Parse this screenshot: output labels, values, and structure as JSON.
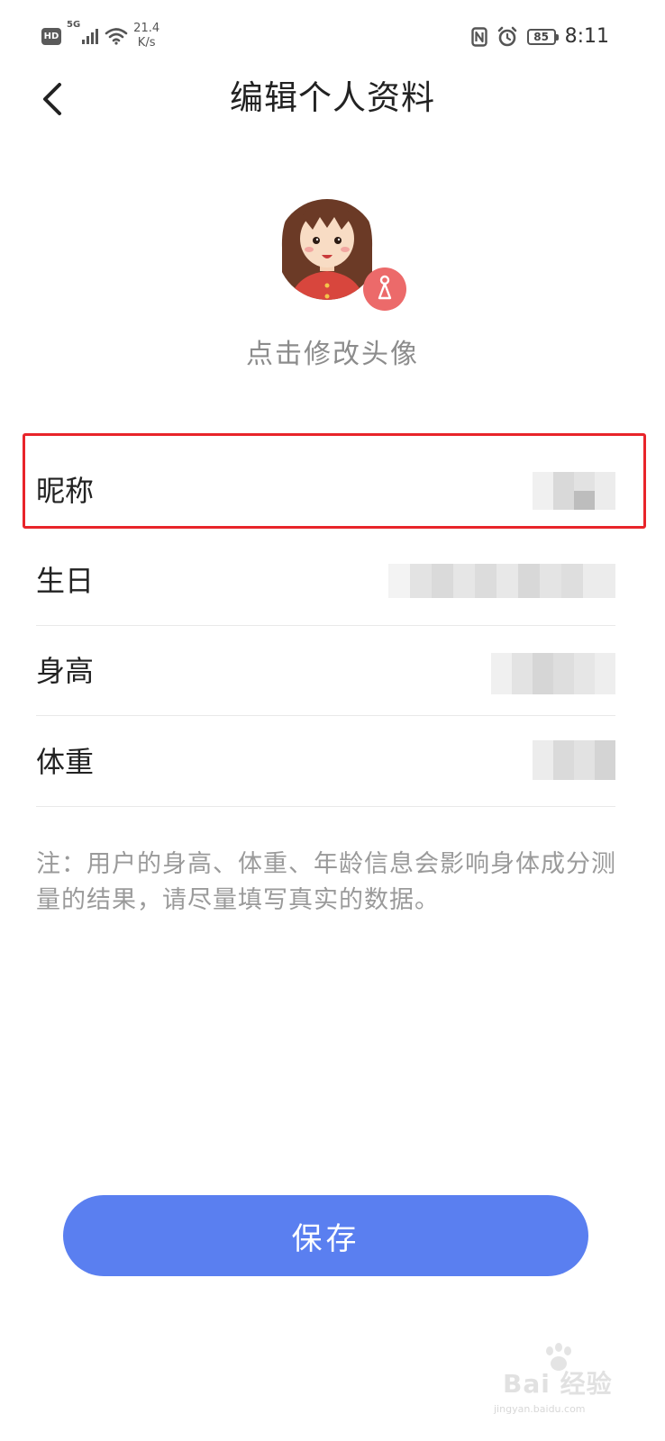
{
  "status_bar": {
    "hd": "HD",
    "network": "5G",
    "speed_value": "21.4",
    "speed_unit": "K/s",
    "battery": "85",
    "time": "8:11"
  },
  "header": {
    "title": "编辑个人资料"
  },
  "avatar": {
    "caption": "点击修改头像"
  },
  "form": {
    "rows": [
      {
        "label": "昵称"
      },
      {
        "label": "生日"
      },
      {
        "label": "身高"
      },
      {
        "label": "体重"
      }
    ]
  },
  "note": {
    "text": "注：用户的身高、体重、年龄信息会影响身体成分测量的结果，请尽量填写真实的数据。"
  },
  "actions": {
    "save_label": "保存"
  },
  "watermark": {
    "text": "Bai 经验",
    "url": "jingyan.baidu.com"
  },
  "colors": {
    "primary": "#5a7ff0",
    "highlight": "#e8242a",
    "gender_badge": "#ec6a6a"
  },
  "icons": {
    "back": "chevron-left-icon",
    "gender": "female-icon",
    "nfc": "nfc-icon",
    "alarm": "alarm-icon"
  }
}
